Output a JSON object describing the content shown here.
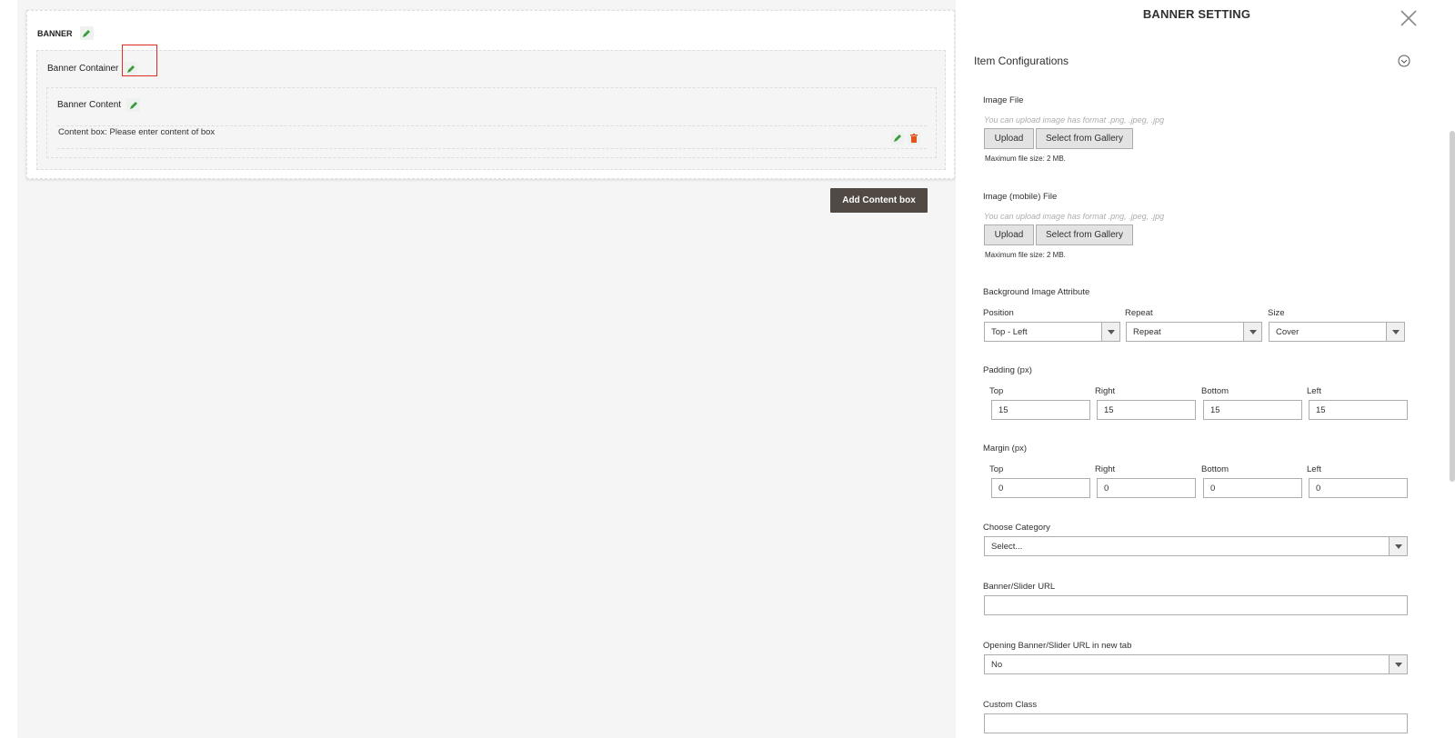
{
  "builder": {
    "banner_title": "BANNER",
    "container_title": "Banner Container",
    "content_title": "Banner Content",
    "content_item_text": "Content box: Please enter content of box",
    "add_button": "Add Content box"
  },
  "panel": {
    "title": "BANNER SETTING",
    "section_title": "Item Configurations",
    "image_file": {
      "label": "Image File",
      "hint": "You can upload image has format .png, .jpeg, .jpg",
      "upload": "Upload",
      "gallery": "Select from Gallery",
      "max_size": "Maximum file size: 2 MB."
    },
    "image_mobile": {
      "label": "Image (mobile) File",
      "hint": "You can upload image has format .png, .jpeg, .jpg",
      "upload": "Upload",
      "gallery": "Select from Gallery",
      "max_size": "Maximum file size: 2 MB."
    },
    "bg_attr": {
      "label": "Background Image Attribute",
      "position_label": "Position",
      "position_value": "Top - Left",
      "repeat_label": "Repeat",
      "repeat_value": "Repeat",
      "size_label": "Size",
      "size_value": "Cover"
    },
    "padding": {
      "label": "Padding (px)",
      "top_label": "Top",
      "right_label": "Right",
      "bottom_label": "Bottom",
      "left_label": "Left",
      "top": "15",
      "right": "15",
      "bottom": "15",
      "left": "15"
    },
    "margin": {
      "label": "Margin (px)",
      "top_label": "Top",
      "right_label": "Right",
      "bottom_label": "Bottom",
      "left_label": "Left",
      "top": "0",
      "right": "0",
      "bottom": "0",
      "left": "0"
    },
    "category": {
      "label": "Choose Category",
      "value": "Select..."
    },
    "url": {
      "label": "Banner/Slider URL",
      "value": ""
    },
    "new_tab": {
      "label": "Opening Banner/Slider URL in new tab",
      "value": "No"
    },
    "custom_class": {
      "label": "Custom Class",
      "value": ""
    }
  },
  "colors": {
    "accent_dark": "#514943",
    "edit_green": "#3c9a3c",
    "delete_red": "#e2541a",
    "highlight_red": "#e02b27"
  }
}
